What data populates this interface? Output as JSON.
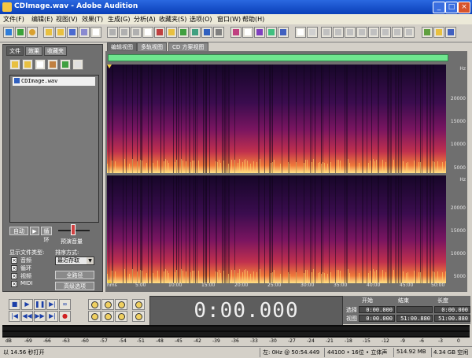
{
  "window": {
    "title": "CDImage.wav - Adobe Audition",
    "controls": [
      "_",
      "□",
      "×"
    ]
  },
  "menu": [
    "文件(F)",
    "编辑(E)",
    "视图(V)",
    "效果(T)",
    "生成(G)",
    "分析(A)",
    "收藏夹(S)",
    "选项(O)",
    "窗口(W)",
    "帮助(H)"
  ],
  "left_panel": {
    "tabs": [
      "文件",
      "效果",
      "收藏夹"
    ],
    "file": "CDImage.wav",
    "auto_play_label": "自动",
    "loop_label": "循环",
    "preview_volume_label": "预演音量",
    "file_types_label": "显示文件类型:",
    "file_types": [
      "音频",
      "循环",
      "视频",
      "MIDI"
    ],
    "sort_label": "排序方式:",
    "sort_value": "最近存取",
    "btn_full_path": "全路径",
    "btn_advanced": "高级选项"
  },
  "view_tabs": [
    "编辑视图",
    "多轨视图",
    "CD 方案视图"
  ],
  "freq_axis": {
    "unit": "Hz",
    "ticks": [
      "20000",
      "15000",
      "10000",
      "5000"
    ]
  },
  "time_axis": {
    "unit": "hms",
    "ticks": [
      "5:00",
      "10:00",
      "15:00",
      "20:00",
      "25:00",
      "30:00",
      "35:00",
      "40:00",
      "45:00",
      "50:00"
    ]
  },
  "time_display": "0:00.000",
  "selection": {
    "headers": [
      "开始",
      "结束",
      "长度"
    ],
    "rows": [
      {
        "label": "选择",
        "begin": "0:00.000",
        "end": "",
        "length": "0:00.000"
      },
      {
        "label": "视图",
        "begin": "0:00.000",
        "end": "51:00.880",
        "length": "51:00.880"
      }
    ]
  },
  "meter_ticks": [
    "dB",
    "-69",
    "-66",
    "-63",
    "-60",
    "-57",
    "-54",
    "-51",
    "-48",
    "-45",
    "-42",
    "-39",
    "-36",
    "-33",
    "-30",
    "-27",
    "-24",
    "-21",
    "-18",
    "-15",
    "-12",
    "-9",
    "-6",
    "-3",
    "0"
  ],
  "status": {
    "open_time": "以 14.56 秒打开",
    "cursor": "左: 0Hz @ 50:54.449",
    "format": "44100 • 16位 • 立体声",
    "size": "514.92 MB",
    "free": "4.34 GB 空闲"
  },
  "colors": {
    "title_bar": "#0a3fb8",
    "panel_gray": "#6f6f6f",
    "overview_green": "#6fe68f",
    "spectro_low": "#1a0a2e",
    "spectro_mid": "#a0206a",
    "spectro_high": "#ffe080"
  }
}
